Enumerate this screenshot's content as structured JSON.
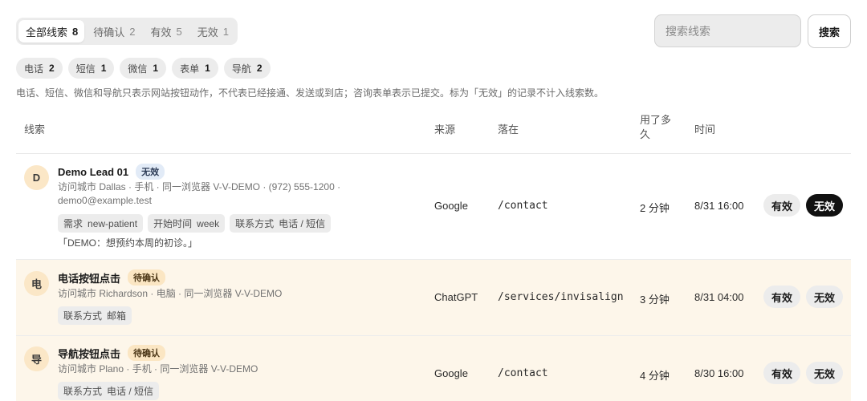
{
  "status_tabs": [
    {
      "label": "全部线索",
      "count": "8"
    },
    {
      "label": "待确认",
      "count": "2"
    },
    {
      "label": "有效",
      "count": "5"
    },
    {
      "label": "无效",
      "count": "1"
    }
  ],
  "search": {
    "placeholder": "搜索线索",
    "button_label": "搜索"
  },
  "type_chips": [
    {
      "label": "电话",
      "count": "2"
    },
    {
      "label": "短信",
      "count": "1"
    },
    {
      "label": "微信",
      "count": "1"
    },
    {
      "label": "表单",
      "count": "1"
    },
    {
      "label": "导航",
      "count": "2"
    }
  ],
  "note": "电话、短信、微信和导航只表示网站按钮动作，不代表已经接通、发送或到店；咨询表单表示已提交。标为「无效」的记录不计入线索数。",
  "columns": {
    "lead": "线索",
    "source": "来源",
    "landing": "落在",
    "duration": "用了多久",
    "time": "时间"
  },
  "actions": {
    "valid": "有效",
    "invalid": "无效"
  },
  "rows": [
    {
      "avatar": "D",
      "name": "Demo Lead 01",
      "status": "无效",
      "meta_line1": "访问城市 Dallas · 手机 · 同一浏览器 V-V-DEMO · (972) 555-1200 ·",
      "meta_line2": "demo0@example.test",
      "tags": [
        {
          "k": "需求",
          "v": "new-patient"
        },
        {
          "k": "开始时间",
          "v": "week"
        },
        {
          "k": "联系方式",
          "v": "电话 / 短信"
        }
      ],
      "quote": "「DEMO：想预约本周的初诊。」",
      "source": "Google",
      "landing": "/contact",
      "duration": "2 分钟",
      "time": "8/31 16:00",
      "selected": "invalid"
    },
    {
      "avatar": "电",
      "name": "电话按钮点击",
      "status": "待确认",
      "meta_line1": "访问城市 Richardson · 电脑 · 同一浏览器 V-V-DEMO",
      "tags": [
        {
          "k": "联系方式",
          "v": "邮箱"
        }
      ],
      "source": "ChatGPT",
      "landing": "/services/invisalign",
      "duration": "3 分钟",
      "time": "8/31 04:00",
      "selected": "none"
    },
    {
      "avatar": "导",
      "name": "导航按钮点击",
      "status": "待确认",
      "meta_line1": "访问城市 Plano · 手机 · 同一浏览器 V-V-DEMO",
      "tags": [
        {
          "k": "联系方式",
          "v": "电话 / 短信"
        }
      ],
      "source": "Google",
      "landing": "/contact",
      "duration": "4 分钟",
      "time": "8/30 16:00",
      "selected": "none"
    }
  ]
}
